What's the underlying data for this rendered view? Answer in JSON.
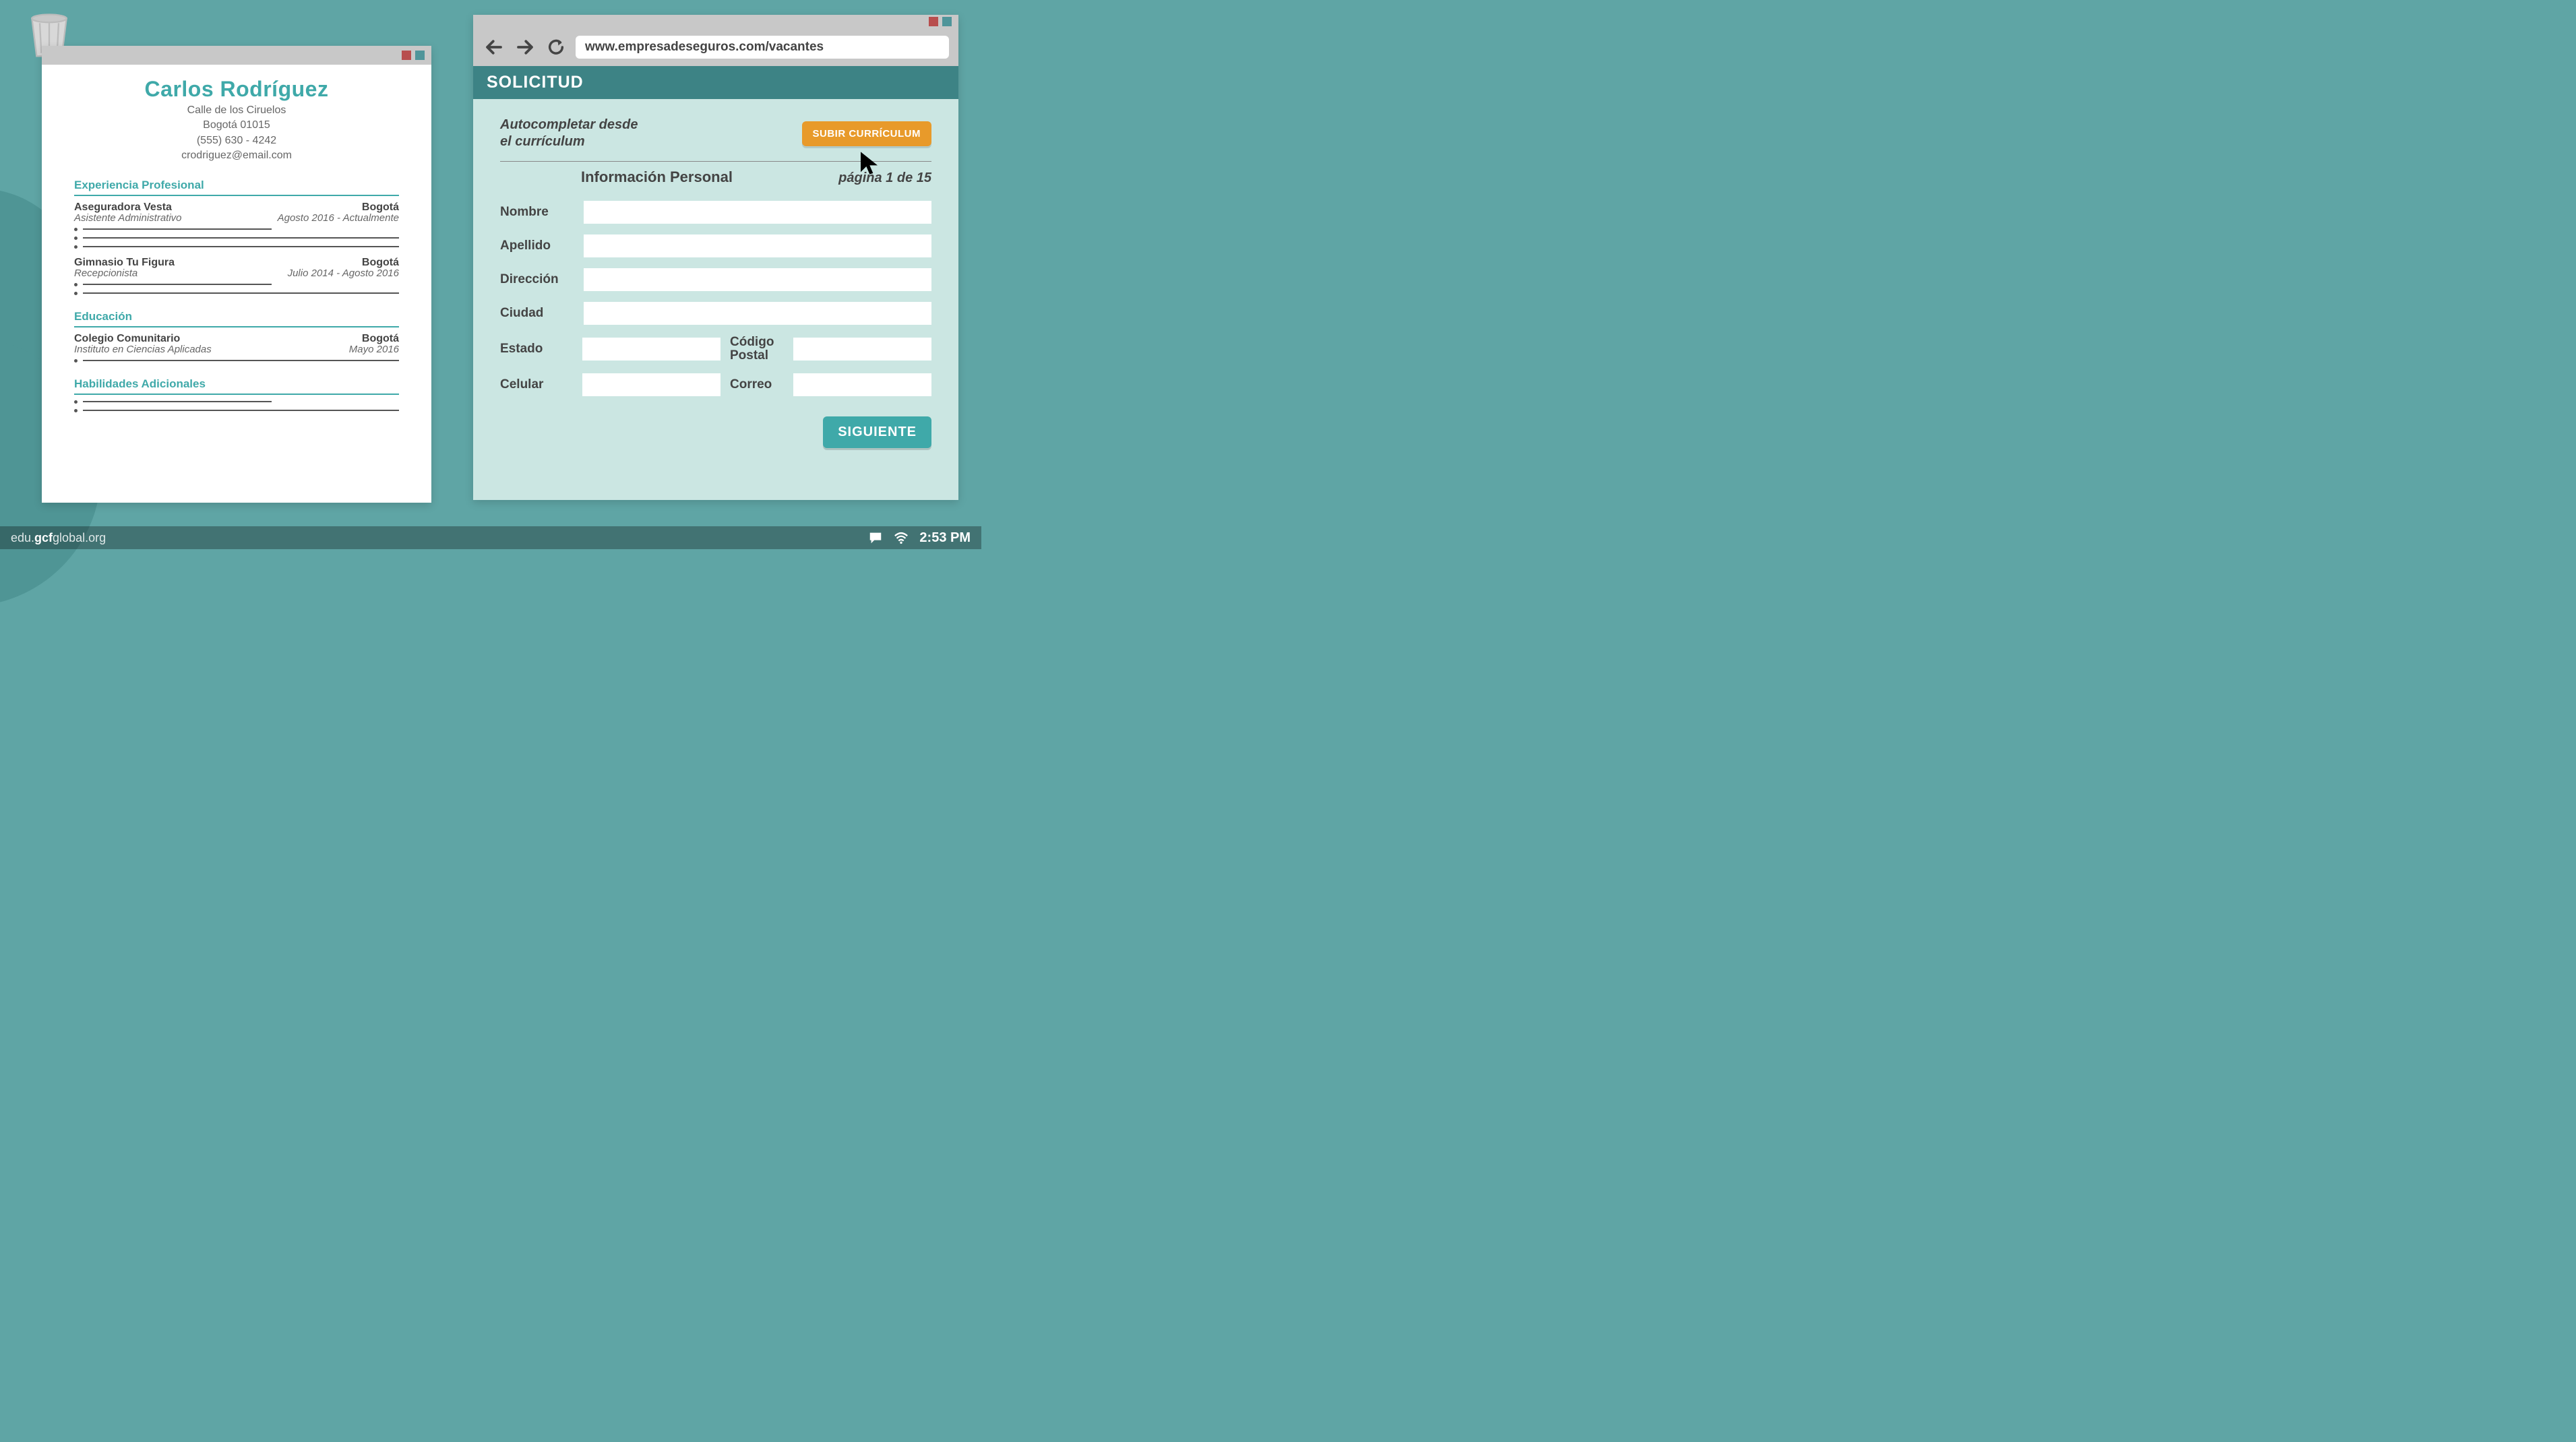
{
  "resume": {
    "name": "Carlos Rodríguez",
    "address_line": "Calle de los Ciruelos",
    "city_zip": "Bogotá 01015",
    "phone": "(555) 630 - 4242",
    "email": "crodriguez@email.com",
    "section_experience": "Experiencia Profesional",
    "jobs": [
      {
        "employer": "Aseguradora Vesta",
        "location": "Bogotá",
        "role": "Asistente Administrativo",
        "dates": "Agosto 2016 - Actualmente"
      },
      {
        "employer": "Gimnasio Tu Figura",
        "location": "Bogotá",
        "role": "Recepcionista",
        "dates": "Julio 2014 - Agosto 2016"
      }
    ],
    "section_education": "Educación",
    "education": {
      "school": "Colegio Comunitario",
      "location": "Bogotá",
      "program": "Instituto en Ciencias Aplicadas",
      "date": "Mayo 2016"
    },
    "section_skills": "Habilidades Adicionales"
  },
  "browser": {
    "url": "www.empresadeseguros.com/vacantes",
    "form": {
      "banner": "SOLICITUD",
      "autocomplete_line1": "Autocompletar desde",
      "autocomplete_line2": "el currículum",
      "upload_label": "SUBIR CURRÍCULUM",
      "section_title": "Información Personal",
      "page_indicator": "página 1 de 15",
      "labels": {
        "nombre": "Nombre",
        "apellido": "Apellido",
        "direccion": "Dirección",
        "ciudad": "Ciudad",
        "estado": "Estado",
        "codigo_postal": "Código Postal",
        "celular": "Celular",
        "correo": "Correo"
      },
      "next_label": "SIGUIENTE"
    }
  },
  "taskbar": {
    "url_prefix": "edu.",
    "url_bold": "gcf",
    "url_suffix": "global.org",
    "clock": "2:53 PM"
  }
}
